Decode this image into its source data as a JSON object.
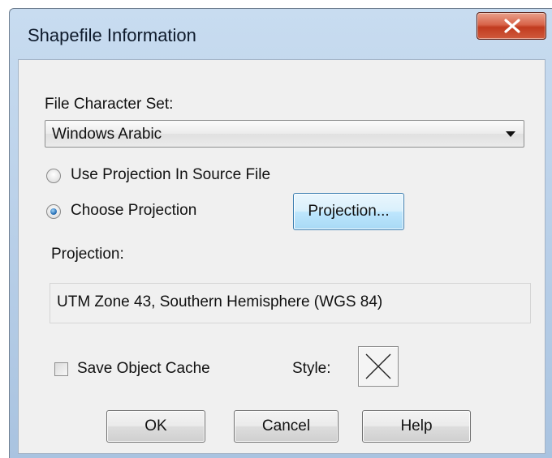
{
  "window": {
    "title": "Shapefile Information",
    "close_icon": "close-x-icon"
  },
  "charset": {
    "label": "File Character Set:",
    "selected": "Windows Arabic"
  },
  "projection_mode": {
    "option_source": "Use Projection In Source File",
    "option_choose": "Choose Projection",
    "selected": "choose",
    "projection_button": "Projection..."
  },
  "projection": {
    "label": "Projection:",
    "value": "UTM Zone 43, Southern Hemisphere (WGS 84)"
  },
  "cache": {
    "label": "Save Object Cache",
    "checked": false
  },
  "style": {
    "label": "Style:",
    "icon": "cross-style-icon"
  },
  "buttons": {
    "ok": "OK",
    "cancel": "Cancel",
    "help": "Help"
  }
}
